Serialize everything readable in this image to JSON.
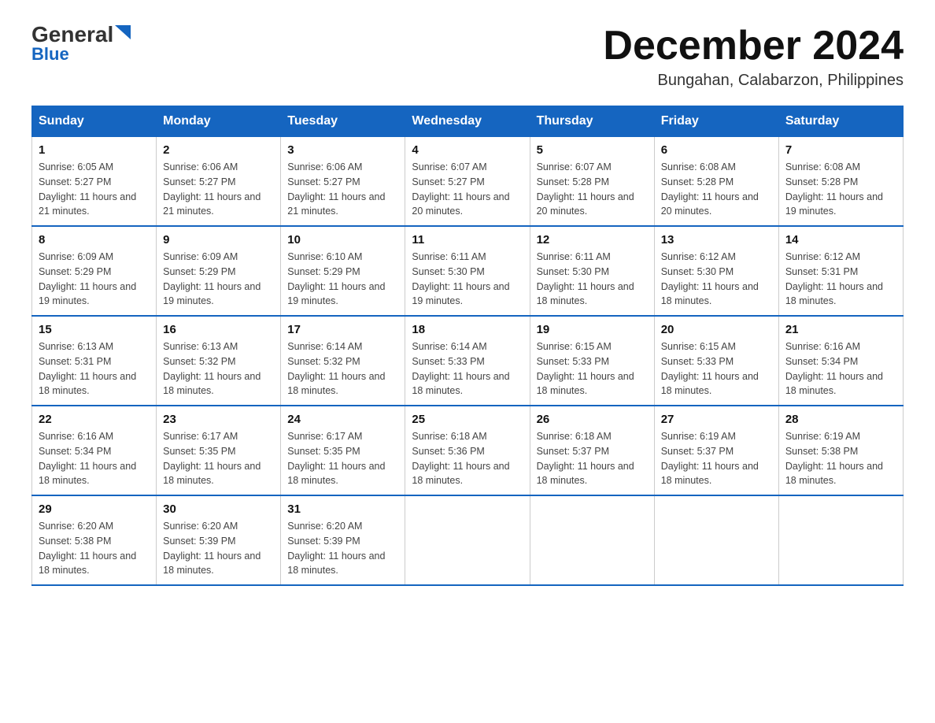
{
  "header": {
    "logo_general": "General",
    "logo_blue": "Blue",
    "month_title": "December 2024",
    "subtitle": "Bungahan, Calabarzon, Philippines"
  },
  "columns": [
    "Sunday",
    "Monday",
    "Tuesday",
    "Wednesday",
    "Thursday",
    "Friday",
    "Saturday"
  ],
  "weeks": [
    [
      {
        "day": "1",
        "sunrise": "6:05 AM",
        "sunset": "5:27 PM",
        "daylight": "11 hours and 21 minutes."
      },
      {
        "day": "2",
        "sunrise": "6:06 AM",
        "sunset": "5:27 PM",
        "daylight": "11 hours and 21 minutes."
      },
      {
        "day": "3",
        "sunrise": "6:06 AM",
        "sunset": "5:27 PM",
        "daylight": "11 hours and 21 minutes."
      },
      {
        "day": "4",
        "sunrise": "6:07 AM",
        "sunset": "5:27 PM",
        "daylight": "11 hours and 20 minutes."
      },
      {
        "day": "5",
        "sunrise": "6:07 AM",
        "sunset": "5:28 PM",
        "daylight": "11 hours and 20 minutes."
      },
      {
        "day": "6",
        "sunrise": "6:08 AM",
        "sunset": "5:28 PM",
        "daylight": "11 hours and 20 minutes."
      },
      {
        "day": "7",
        "sunrise": "6:08 AM",
        "sunset": "5:28 PM",
        "daylight": "11 hours and 19 minutes."
      }
    ],
    [
      {
        "day": "8",
        "sunrise": "6:09 AM",
        "sunset": "5:29 PM",
        "daylight": "11 hours and 19 minutes."
      },
      {
        "day": "9",
        "sunrise": "6:09 AM",
        "sunset": "5:29 PM",
        "daylight": "11 hours and 19 minutes."
      },
      {
        "day": "10",
        "sunrise": "6:10 AM",
        "sunset": "5:29 PM",
        "daylight": "11 hours and 19 minutes."
      },
      {
        "day": "11",
        "sunrise": "6:11 AM",
        "sunset": "5:30 PM",
        "daylight": "11 hours and 19 minutes."
      },
      {
        "day": "12",
        "sunrise": "6:11 AM",
        "sunset": "5:30 PM",
        "daylight": "11 hours and 18 minutes."
      },
      {
        "day": "13",
        "sunrise": "6:12 AM",
        "sunset": "5:30 PM",
        "daylight": "11 hours and 18 minutes."
      },
      {
        "day": "14",
        "sunrise": "6:12 AM",
        "sunset": "5:31 PM",
        "daylight": "11 hours and 18 minutes."
      }
    ],
    [
      {
        "day": "15",
        "sunrise": "6:13 AM",
        "sunset": "5:31 PM",
        "daylight": "11 hours and 18 minutes."
      },
      {
        "day": "16",
        "sunrise": "6:13 AM",
        "sunset": "5:32 PM",
        "daylight": "11 hours and 18 minutes."
      },
      {
        "day": "17",
        "sunrise": "6:14 AM",
        "sunset": "5:32 PM",
        "daylight": "11 hours and 18 minutes."
      },
      {
        "day": "18",
        "sunrise": "6:14 AM",
        "sunset": "5:33 PM",
        "daylight": "11 hours and 18 minutes."
      },
      {
        "day": "19",
        "sunrise": "6:15 AM",
        "sunset": "5:33 PM",
        "daylight": "11 hours and 18 minutes."
      },
      {
        "day": "20",
        "sunrise": "6:15 AM",
        "sunset": "5:33 PM",
        "daylight": "11 hours and 18 minutes."
      },
      {
        "day": "21",
        "sunrise": "6:16 AM",
        "sunset": "5:34 PM",
        "daylight": "11 hours and 18 minutes."
      }
    ],
    [
      {
        "day": "22",
        "sunrise": "6:16 AM",
        "sunset": "5:34 PM",
        "daylight": "11 hours and 18 minutes."
      },
      {
        "day": "23",
        "sunrise": "6:17 AM",
        "sunset": "5:35 PM",
        "daylight": "11 hours and 18 minutes."
      },
      {
        "day": "24",
        "sunrise": "6:17 AM",
        "sunset": "5:35 PM",
        "daylight": "11 hours and 18 minutes."
      },
      {
        "day": "25",
        "sunrise": "6:18 AM",
        "sunset": "5:36 PM",
        "daylight": "11 hours and 18 minutes."
      },
      {
        "day": "26",
        "sunrise": "6:18 AM",
        "sunset": "5:37 PM",
        "daylight": "11 hours and 18 minutes."
      },
      {
        "day": "27",
        "sunrise": "6:19 AM",
        "sunset": "5:37 PM",
        "daylight": "11 hours and 18 minutes."
      },
      {
        "day": "28",
        "sunrise": "6:19 AM",
        "sunset": "5:38 PM",
        "daylight": "11 hours and 18 minutes."
      }
    ],
    [
      {
        "day": "29",
        "sunrise": "6:20 AM",
        "sunset": "5:38 PM",
        "daylight": "11 hours and 18 minutes."
      },
      {
        "day": "30",
        "sunrise": "6:20 AM",
        "sunset": "5:39 PM",
        "daylight": "11 hours and 18 minutes."
      },
      {
        "day": "31",
        "sunrise": "6:20 AM",
        "sunset": "5:39 PM",
        "daylight": "11 hours and 18 minutes."
      },
      null,
      null,
      null,
      null
    ]
  ],
  "labels": {
    "sunrise": "Sunrise:",
    "sunset": "Sunset:",
    "daylight": "Daylight:"
  }
}
